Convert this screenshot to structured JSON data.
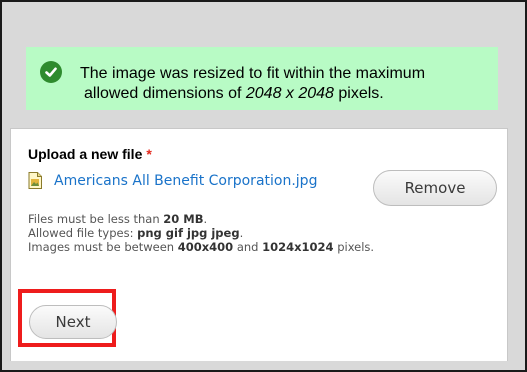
{
  "notice": {
    "icon": "check-circle-icon",
    "line1": "The image was resized to fit within the maximum",
    "line2_prefix": "allowed dimensions of ",
    "line2_dims": "2048 x 2048",
    "line2_suffix": " pixels."
  },
  "upload": {
    "label": "Upload a new file",
    "required_mark": "*",
    "file_icon": "image-file-icon",
    "file_name": "Americans All Benefit Corporation.jpg",
    "remove_label": "Remove",
    "help": {
      "size_prefix": "Files must be less than ",
      "size_value": "20 MB",
      "size_suffix": ".",
      "types_prefix": "Allowed file types: ",
      "types_value": "png gif jpg jpeg",
      "types_suffix": ".",
      "dims_prefix": "Images must be between ",
      "dims_min": "400x400",
      "dims_mid": " and ",
      "dims_max": "1024x1024",
      "dims_suffix": " pixels."
    }
  },
  "actions": {
    "next_label": "Next"
  },
  "colors": {
    "notice_bg": "#b8fbc5",
    "check": "#2e8b2e",
    "link": "#1a73c9",
    "required": "#e3291d",
    "highlight": "#ee1c1c"
  }
}
